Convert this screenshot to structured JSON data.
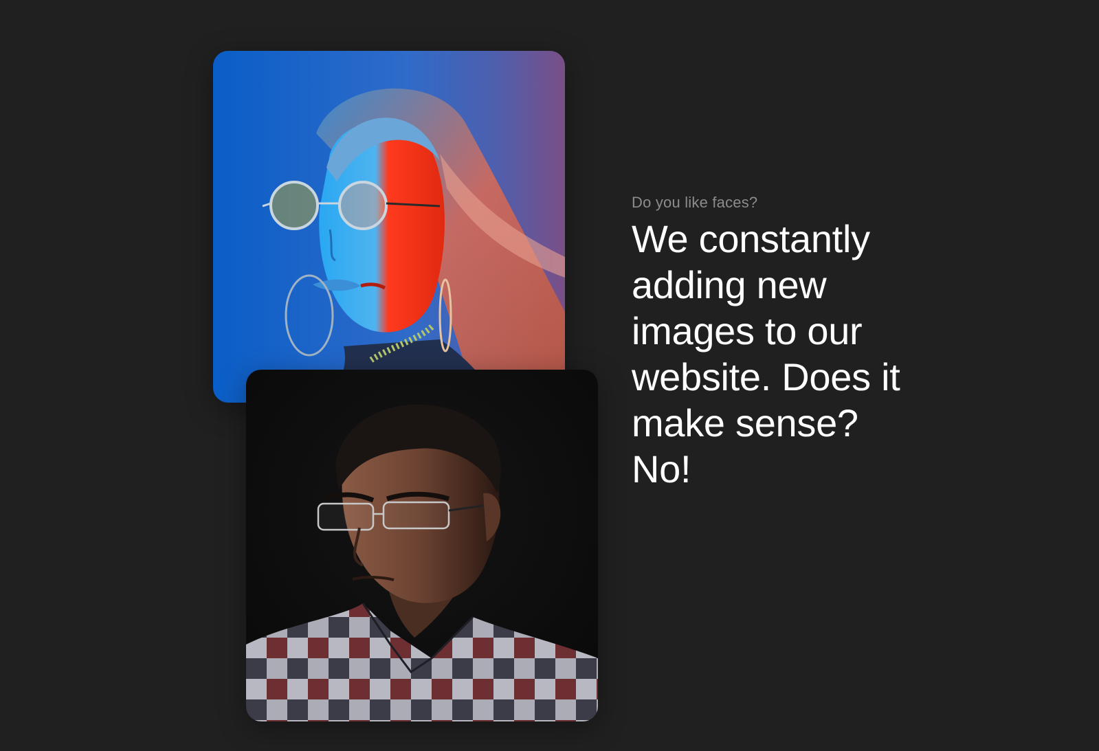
{
  "images": [
    {
      "name": "portrait-woman-neon",
      "description_icon": "portrait-photo"
    },
    {
      "name": "portrait-man-dark",
      "description_icon": "portrait-photo"
    }
  ],
  "section": {
    "eyebrow": "Do you like faces?",
    "headline": "We constantly adding new images to our website. Does it make sense? No!"
  },
  "colors": {
    "background": "#202020",
    "eyebrow": "#8c8c8c",
    "headline": "#ffffff"
  }
}
